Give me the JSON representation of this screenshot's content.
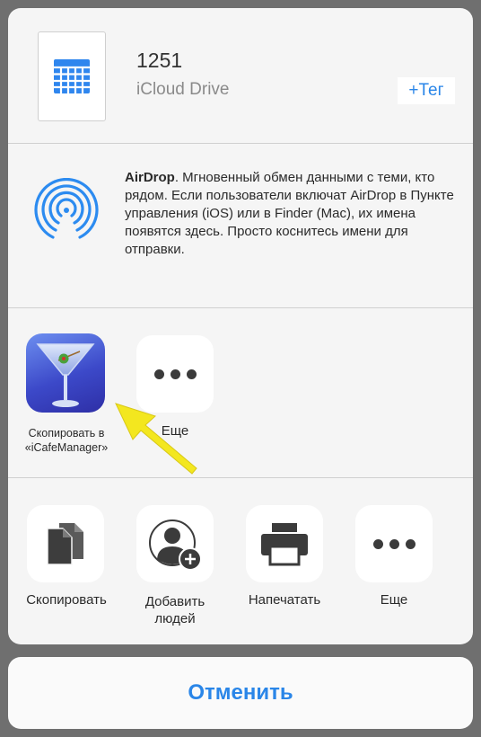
{
  "file": {
    "name": "1251",
    "location": "iCloud Drive",
    "tag_label": "+Тег"
  },
  "airdrop": {
    "title": "AirDrop",
    "description": ". Мгновенный обмен данными с теми, кто рядом. Если пользователи включат AirDrop в Пункте управления (iOS) или в Finder (Mac), их имена появятся здесь. Просто коснитесь имени для отправки."
  },
  "apps": [
    {
      "label": "Скопировать в «iCafeManager»",
      "icon": "martini-glass-icon"
    },
    {
      "label": "Еще",
      "icon": "more-dots-icon"
    }
  ],
  "actions": [
    {
      "label": "Скопировать",
      "icon": "copy-documents-icon"
    },
    {
      "label": "Добавить людей",
      "icon": "add-person-icon"
    },
    {
      "label": "Напечатать",
      "icon": "printer-icon"
    },
    {
      "label": "Еще",
      "icon": "more-dots-icon"
    }
  ],
  "cancel_label": "Отменить",
  "colors": {
    "accent": "#2a86e8",
    "sheet": "#f5f5f5",
    "backdrop": "#6f6f6f",
    "arrow": "#f3e71f"
  }
}
